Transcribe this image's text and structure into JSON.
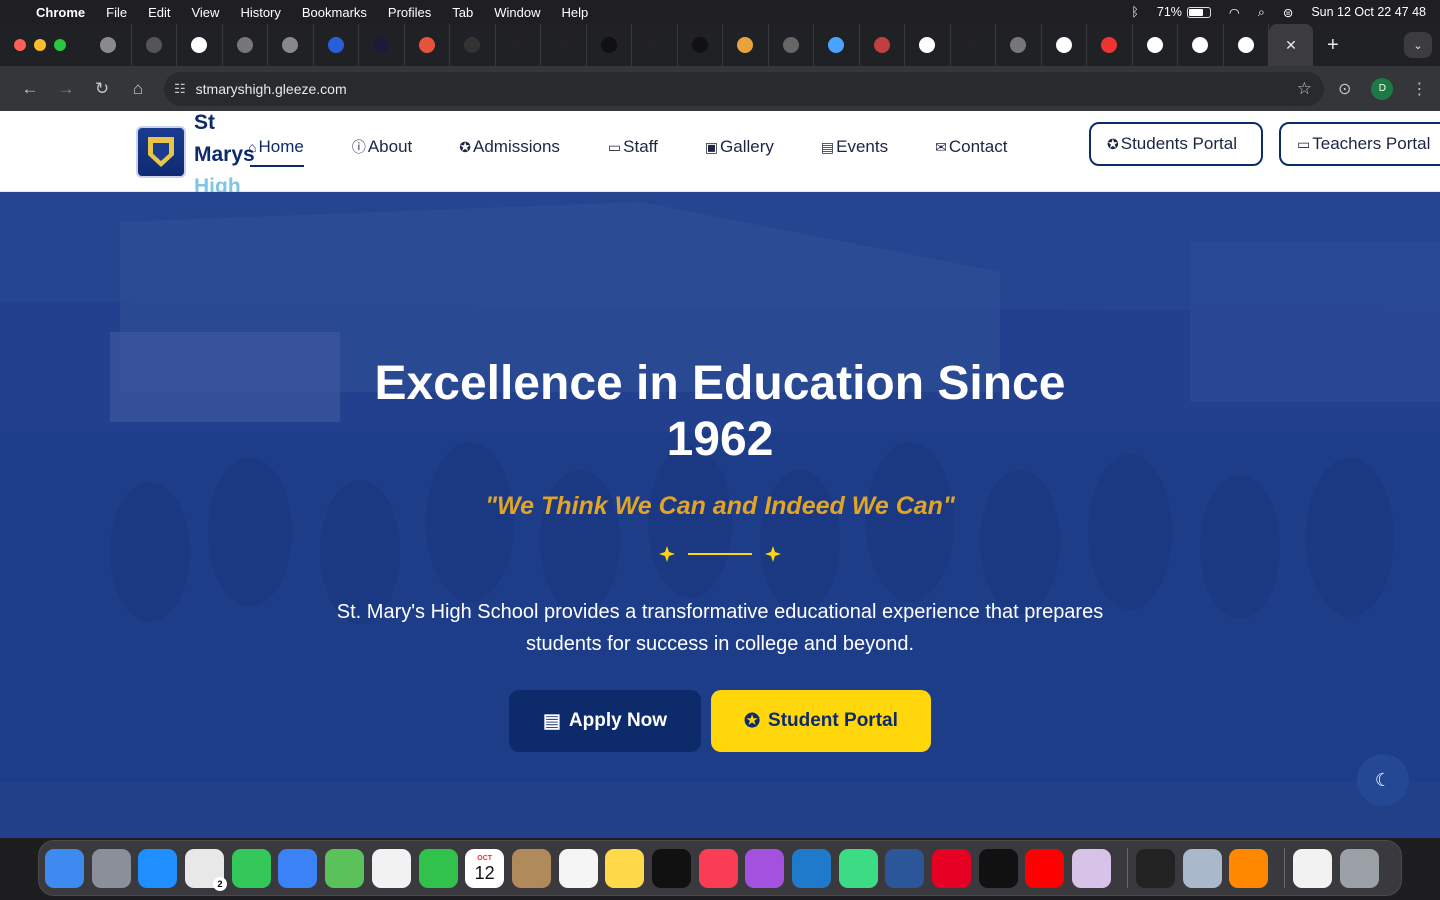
{
  "menubar": {
    "app": "Chrome",
    "items": [
      "File",
      "Edit",
      "View",
      "History",
      "Bookmarks",
      "Profiles",
      "Tab",
      "Window",
      "Help"
    ],
    "battery": "71%",
    "battery_level": 0.71,
    "datetime": "Sun 12 Oct  22 47 48"
  },
  "browser": {
    "active_tab_close": "✕",
    "new_tab": "+",
    "url": "stmaryshigh.gleeze.com",
    "profile_initial": "D"
  },
  "site": {
    "brand": {
      "line1": "St",
      "line2": "Marys",
      "line3": "High"
    },
    "nav": [
      {
        "label": "Home",
        "icon": "home-icon"
      },
      {
        "label": "About",
        "icon": "info-icon"
      },
      {
        "label": "Admissions",
        "icon": "graduate-icon"
      },
      {
        "label": "Staff",
        "icon": "teacher-icon"
      },
      {
        "label": "Gallery",
        "icon": "camera-icon"
      },
      {
        "label": "Events",
        "icon": "newspaper-icon"
      },
      {
        "label": "Contact",
        "icon": "envelope-icon"
      }
    ],
    "students_portal": "Students Portal",
    "teachers_portal": "Teachers Portal",
    "hero": {
      "title": "Excellence in Education Since 1962",
      "motto": "\"We Think We Can and Indeed We Can\"",
      "description": "St. Mary's High School provides a transformative educational experience that prepares students for success in college and beyond.",
      "apply_label": "Apply Now",
      "student_portal_label": "Student Portal"
    },
    "colors": {
      "primary": "#0d2b6b",
      "accent": "#ffd60a",
      "motto": "#e0a526",
      "brand_high": "#7fc6e6"
    }
  },
  "dock": {
    "calendar_month": "OCT",
    "calendar_day": "12",
    "chrome_badge": "2"
  }
}
